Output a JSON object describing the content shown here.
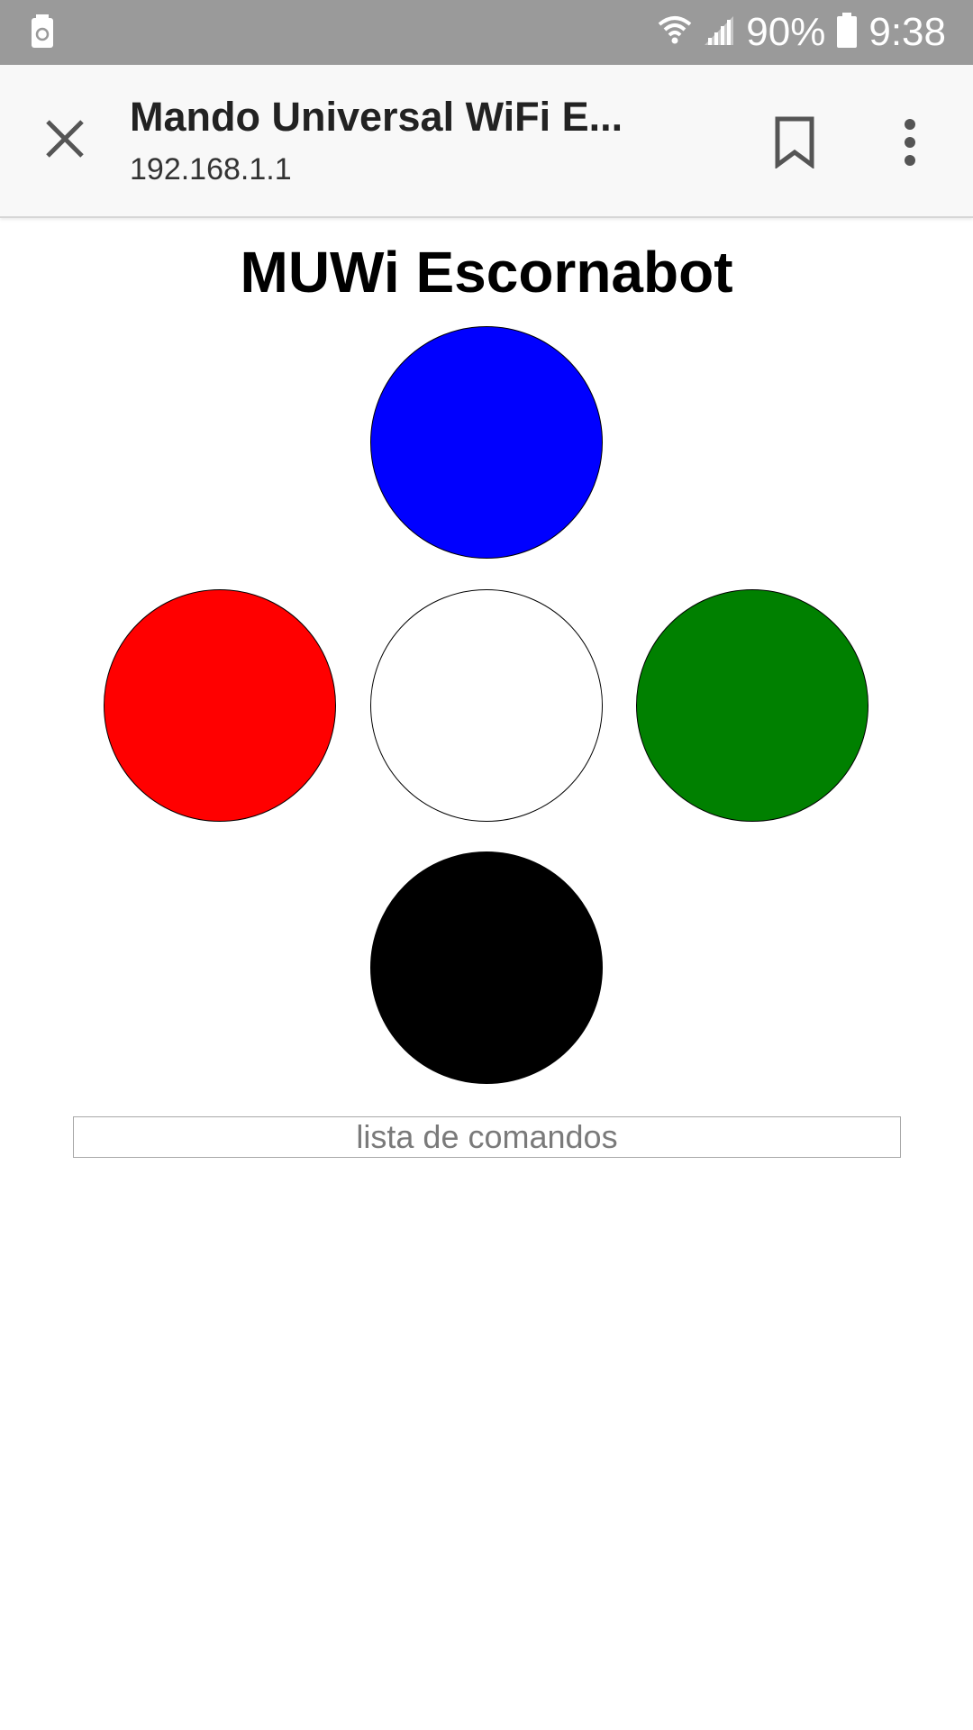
{
  "status_bar": {
    "battery_percent": "90%",
    "time": "9:38",
    "icons": [
      "battery-saver-icon",
      "wifi-icon",
      "signal-icon",
      "battery-icon"
    ]
  },
  "toolbar": {
    "page_title": "Mando Universal WiFi E...",
    "url": "192.168.1.1",
    "icons": [
      "close-icon",
      "bookmark-icon",
      "overflow-menu-icon"
    ]
  },
  "main": {
    "heading": "MUWi Escornabot",
    "buttons": {
      "up_color": "#0000ff",
      "left_color": "#ff0000",
      "center_color": "#ffffff",
      "right_color": "#008000",
      "down_color": "#000000"
    },
    "command_input": {
      "placeholder": "lista de comandos",
      "value": ""
    }
  },
  "colors": {
    "status_bar": "#9a9a9a",
    "toolbar": "#f8f8f8"
  }
}
